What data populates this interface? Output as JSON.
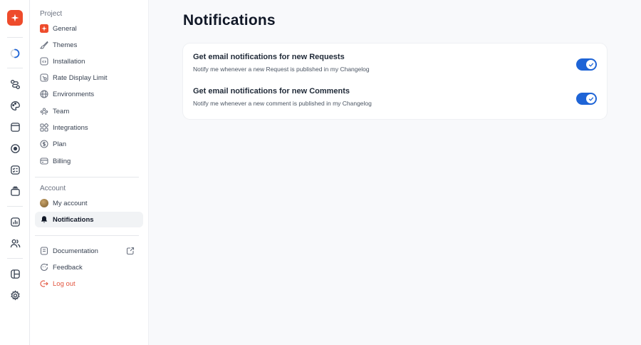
{
  "sidebar": {
    "project_label": "Project",
    "project_items": [
      {
        "label": "General",
        "icon": "brand-logo-icon"
      },
      {
        "label": "Themes",
        "icon": "brush-icon"
      },
      {
        "label": "Installation",
        "icon": "code-icon"
      },
      {
        "label": "Rate Display Limit",
        "icon": "gauge-icon"
      },
      {
        "label": "Environments",
        "icon": "globe-icon"
      },
      {
        "label": "Team",
        "icon": "team-icon"
      },
      {
        "label": "Integrations",
        "icon": "puzzle-icon"
      },
      {
        "label": "Plan",
        "icon": "dollar-icon"
      },
      {
        "label": "Billing",
        "icon": "billing-icon"
      }
    ],
    "account_label": "Account",
    "account_items": [
      {
        "label": "My account",
        "icon": "avatar"
      },
      {
        "label": "Notifications",
        "icon": "bell-icon",
        "active": true
      }
    ],
    "footer_items": [
      {
        "label": "Documentation",
        "icon": "book-icon"
      },
      {
        "label": "Feedback",
        "icon": "feedback-icon"
      },
      {
        "label": "Log out",
        "icon": "logout-icon"
      }
    ]
  },
  "main": {
    "title": "Notifications",
    "settings": [
      {
        "title": "Get email notifications for new Requests",
        "description": "Notify me whenever a new Request is published in my Changelog",
        "enabled": true
      },
      {
        "title": "Get email notifications for new Comments",
        "description": "Notify me whenever a new comment is published in my Changelog",
        "enabled": true
      }
    ]
  },
  "colors": {
    "brand": "#ee4b2b",
    "toggle_on": "#1e64d6",
    "logout": "#e2553f"
  }
}
